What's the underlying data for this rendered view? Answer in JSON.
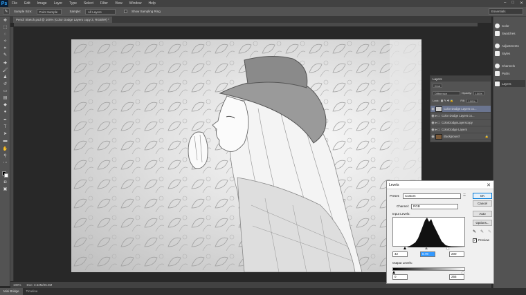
{
  "menubar": {
    "logo": "Ps",
    "items": [
      "File",
      "Edit",
      "Image",
      "Layer",
      "Type",
      "Select",
      "Filter",
      "View",
      "Window",
      "Help"
    ],
    "window_controls": [
      "–",
      "□",
      "✕"
    ]
  },
  "options": {
    "tool_icon": "eyedropper-icon",
    "sample_size_label": "Sample Size:",
    "sample_size_value": "Point Sample",
    "sample_label": "Sample:",
    "sample_value": "All Layers",
    "show_ring_label": "Show Sampling Ring",
    "workspace": "Essentials"
  },
  "document": {
    "tab_title": "Pencil Sketch.psd @ 100% (Color Dodge Layers copy 3, RGB/8#) *"
  },
  "status": {
    "zoom": "100%",
    "doc_info": "Doc: 3.52M/25.0M"
  },
  "bottom_tabs": [
    "Mini Bridge",
    "Timeline"
  ],
  "right_panels": [
    "Color",
    "Swatches",
    "Adjustments",
    "Styles",
    "Channels",
    "Paths",
    "Layers"
  ],
  "layers": {
    "title": "Layers",
    "kind_label": "Kind",
    "blend_mode": "Difference",
    "opacity_label": "Opacity:",
    "opacity_value": "100%",
    "lock_label": "Lock:",
    "fill_label": "Fill:",
    "fill_value": "100%",
    "items": [
      {
        "name": "Color Dodge Layers co...",
        "type": "layer",
        "selected": true
      },
      {
        "name": "Color Dodge Layers co...",
        "type": "group"
      },
      {
        "name": "ColorDodgeLayerscopy",
        "type": "group"
      },
      {
        "name": "ColorDodge Layers",
        "type": "group"
      },
      {
        "name": "Background",
        "type": "background"
      }
    ]
  },
  "levels": {
    "title": "Levels",
    "close": "✕",
    "preset_label": "Preset:",
    "preset_value": "Custom",
    "channel_label": "Channel:",
    "channel_value": "RGB",
    "input_label": "Input Levels:",
    "input_black": "42",
    "input_gamma": "0.78",
    "input_white": "200",
    "output_label": "Output Levels:",
    "output_black": "0",
    "output_white": "255",
    "buttons": {
      "ok": "OK",
      "cancel": "Cancel",
      "auto": "Auto",
      "options": "Options..."
    },
    "preview_label": "Preview",
    "preview_checked": "✓"
  }
}
